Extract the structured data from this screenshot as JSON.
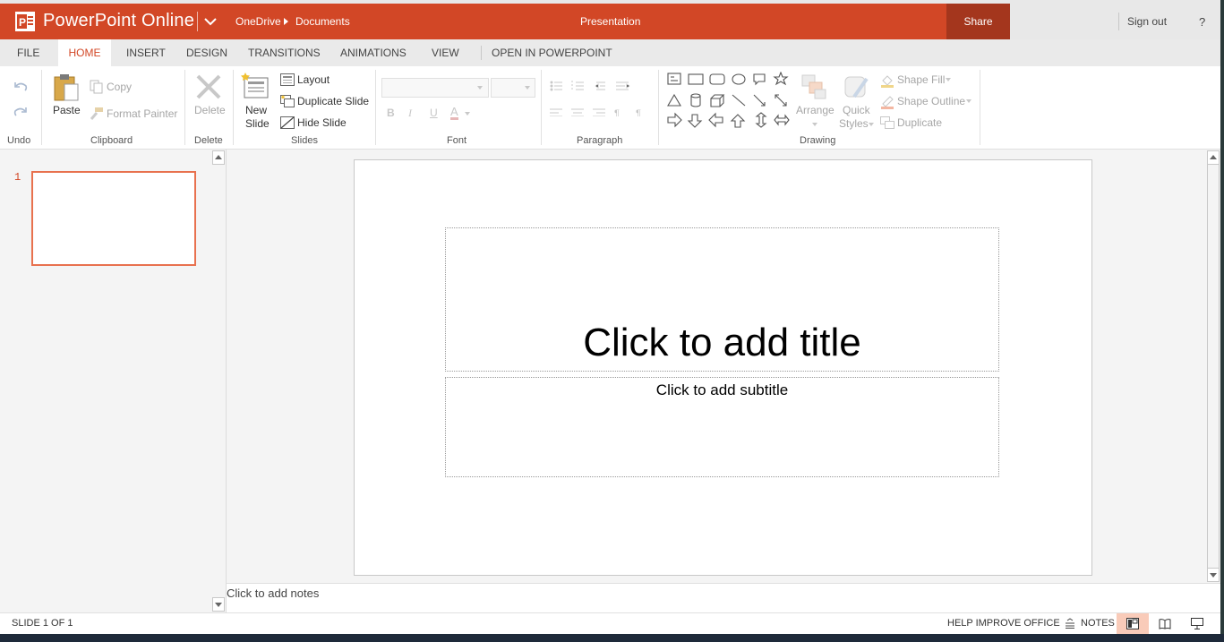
{
  "app": {
    "name": "PowerPoint Online",
    "breadcrumb": [
      "OneDrive",
      "Documents"
    ],
    "document_title": "Presentation",
    "share_label": "Share",
    "signout_label": "Sign out",
    "help_label": "?"
  },
  "tabs": [
    {
      "label": "FILE",
      "active": false
    },
    {
      "label": "HOME",
      "active": true
    },
    {
      "label": "INSERT",
      "active": false
    },
    {
      "label": "DESIGN",
      "active": false
    },
    {
      "label": "TRANSITIONS",
      "active": false
    },
    {
      "label": "ANIMATIONS",
      "active": false
    },
    {
      "label": "VIEW",
      "active": false
    },
    {
      "label": "OPEN IN POWERPOINT",
      "active": false
    }
  ],
  "ribbon": {
    "undo_group": "Undo",
    "clipboard": {
      "group": "Clipboard",
      "paste": "Paste",
      "copy": "Copy",
      "format_painter": "Format Painter"
    },
    "delete": {
      "group": "Delete",
      "label": "Delete"
    },
    "slides": {
      "group": "Slides",
      "new_slide_line1": "New",
      "new_slide_line2": "Slide",
      "layout": "Layout",
      "duplicate_slide": "Duplicate Slide",
      "hide_slide": "Hide Slide"
    },
    "font_group": "Font",
    "paragraph_group": "Paragraph",
    "drawing": {
      "group": "Drawing",
      "arrange": "Arrange",
      "quick_line1": "Quick",
      "quick_line2": "Styles",
      "shape_fill": "Shape Fill",
      "shape_outline": "Shape Outline",
      "duplicate": "Duplicate"
    }
  },
  "slide_pane": {
    "slide_number": "1"
  },
  "slide": {
    "title_placeholder": "Click to add title",
    "subtitle_placeholder": "Click to add subtitle"
  },
  "notes_placeholder": "Click to add notes",
  "status": {
    "slide_count": "SLIDE 1 OF 1",
    "help_improve": "HELP IMPROVE OFFICE",
    "notes": "NOTES"
  },
  "colors": {
    "brand": "#d24726",
    "share_bg": "#a4361d",
    "active_view": "#f9cbb9"
  }
}
